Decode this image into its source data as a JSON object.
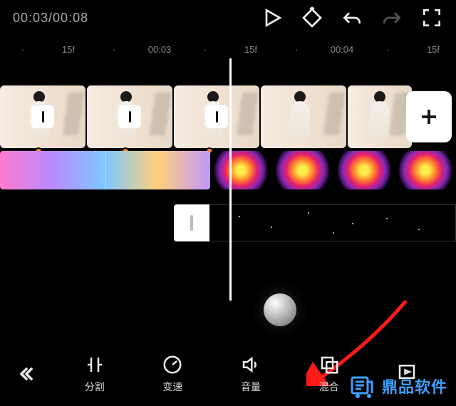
{
  "playback": {
    "current": "00:03",
    "total": "00:08",
    "display": "00:03/00:08"
  },
  "ruler": [
    "·",
    "15f",
    "·",
    "00:03",
    "·",
    "15f",
    "·",
    "00:04",
    "·",
    "15f"
  ],
  "video_track": {
    "clips": [
      {
        "has_transition": true
      },
      {
        "has_transition": true
      },
      {
        "has_transition": true
      },
      {
        "has_transition": false
      },
      {
        "has_transition": false
      }
    ],
    "add_label": "+"
  },
  "fx_track": {
    "ring_count": 4
  },
  "toolbar": {
    "items": [
      {
        "name": "split",
        "label": "分割"
      },
      {
        "name": "speed",
        "label": "变速"
      },
      {
        "name": "volume",
        "label": "音量"
      },
      {
        "name": "blend",
        "label": "混合"
      },
      {
        "name": "canvas",
        "label": ""
      }
    ]
  },
  "watermark": {
    "text": "鼎品软件",
    "brand_color": "#3ea0ff"
  }
}
